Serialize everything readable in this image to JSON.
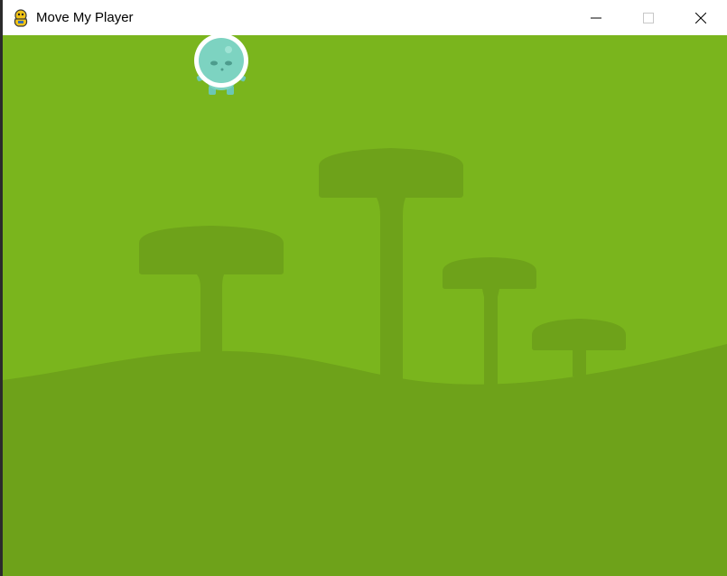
{
  "window": {
    "title": "Move My Player",
    "app_icon": "pygame-snake-icon",
    "controls": [
      "minimize-icon",
      "maximize-icon",
      "close-icon"
    ]
  },
  "scene": {
    "background": "#7ab51d",
    "foreground": "#6ea21a",
    "player": "alien-astronaut-sprite"
  }
}
